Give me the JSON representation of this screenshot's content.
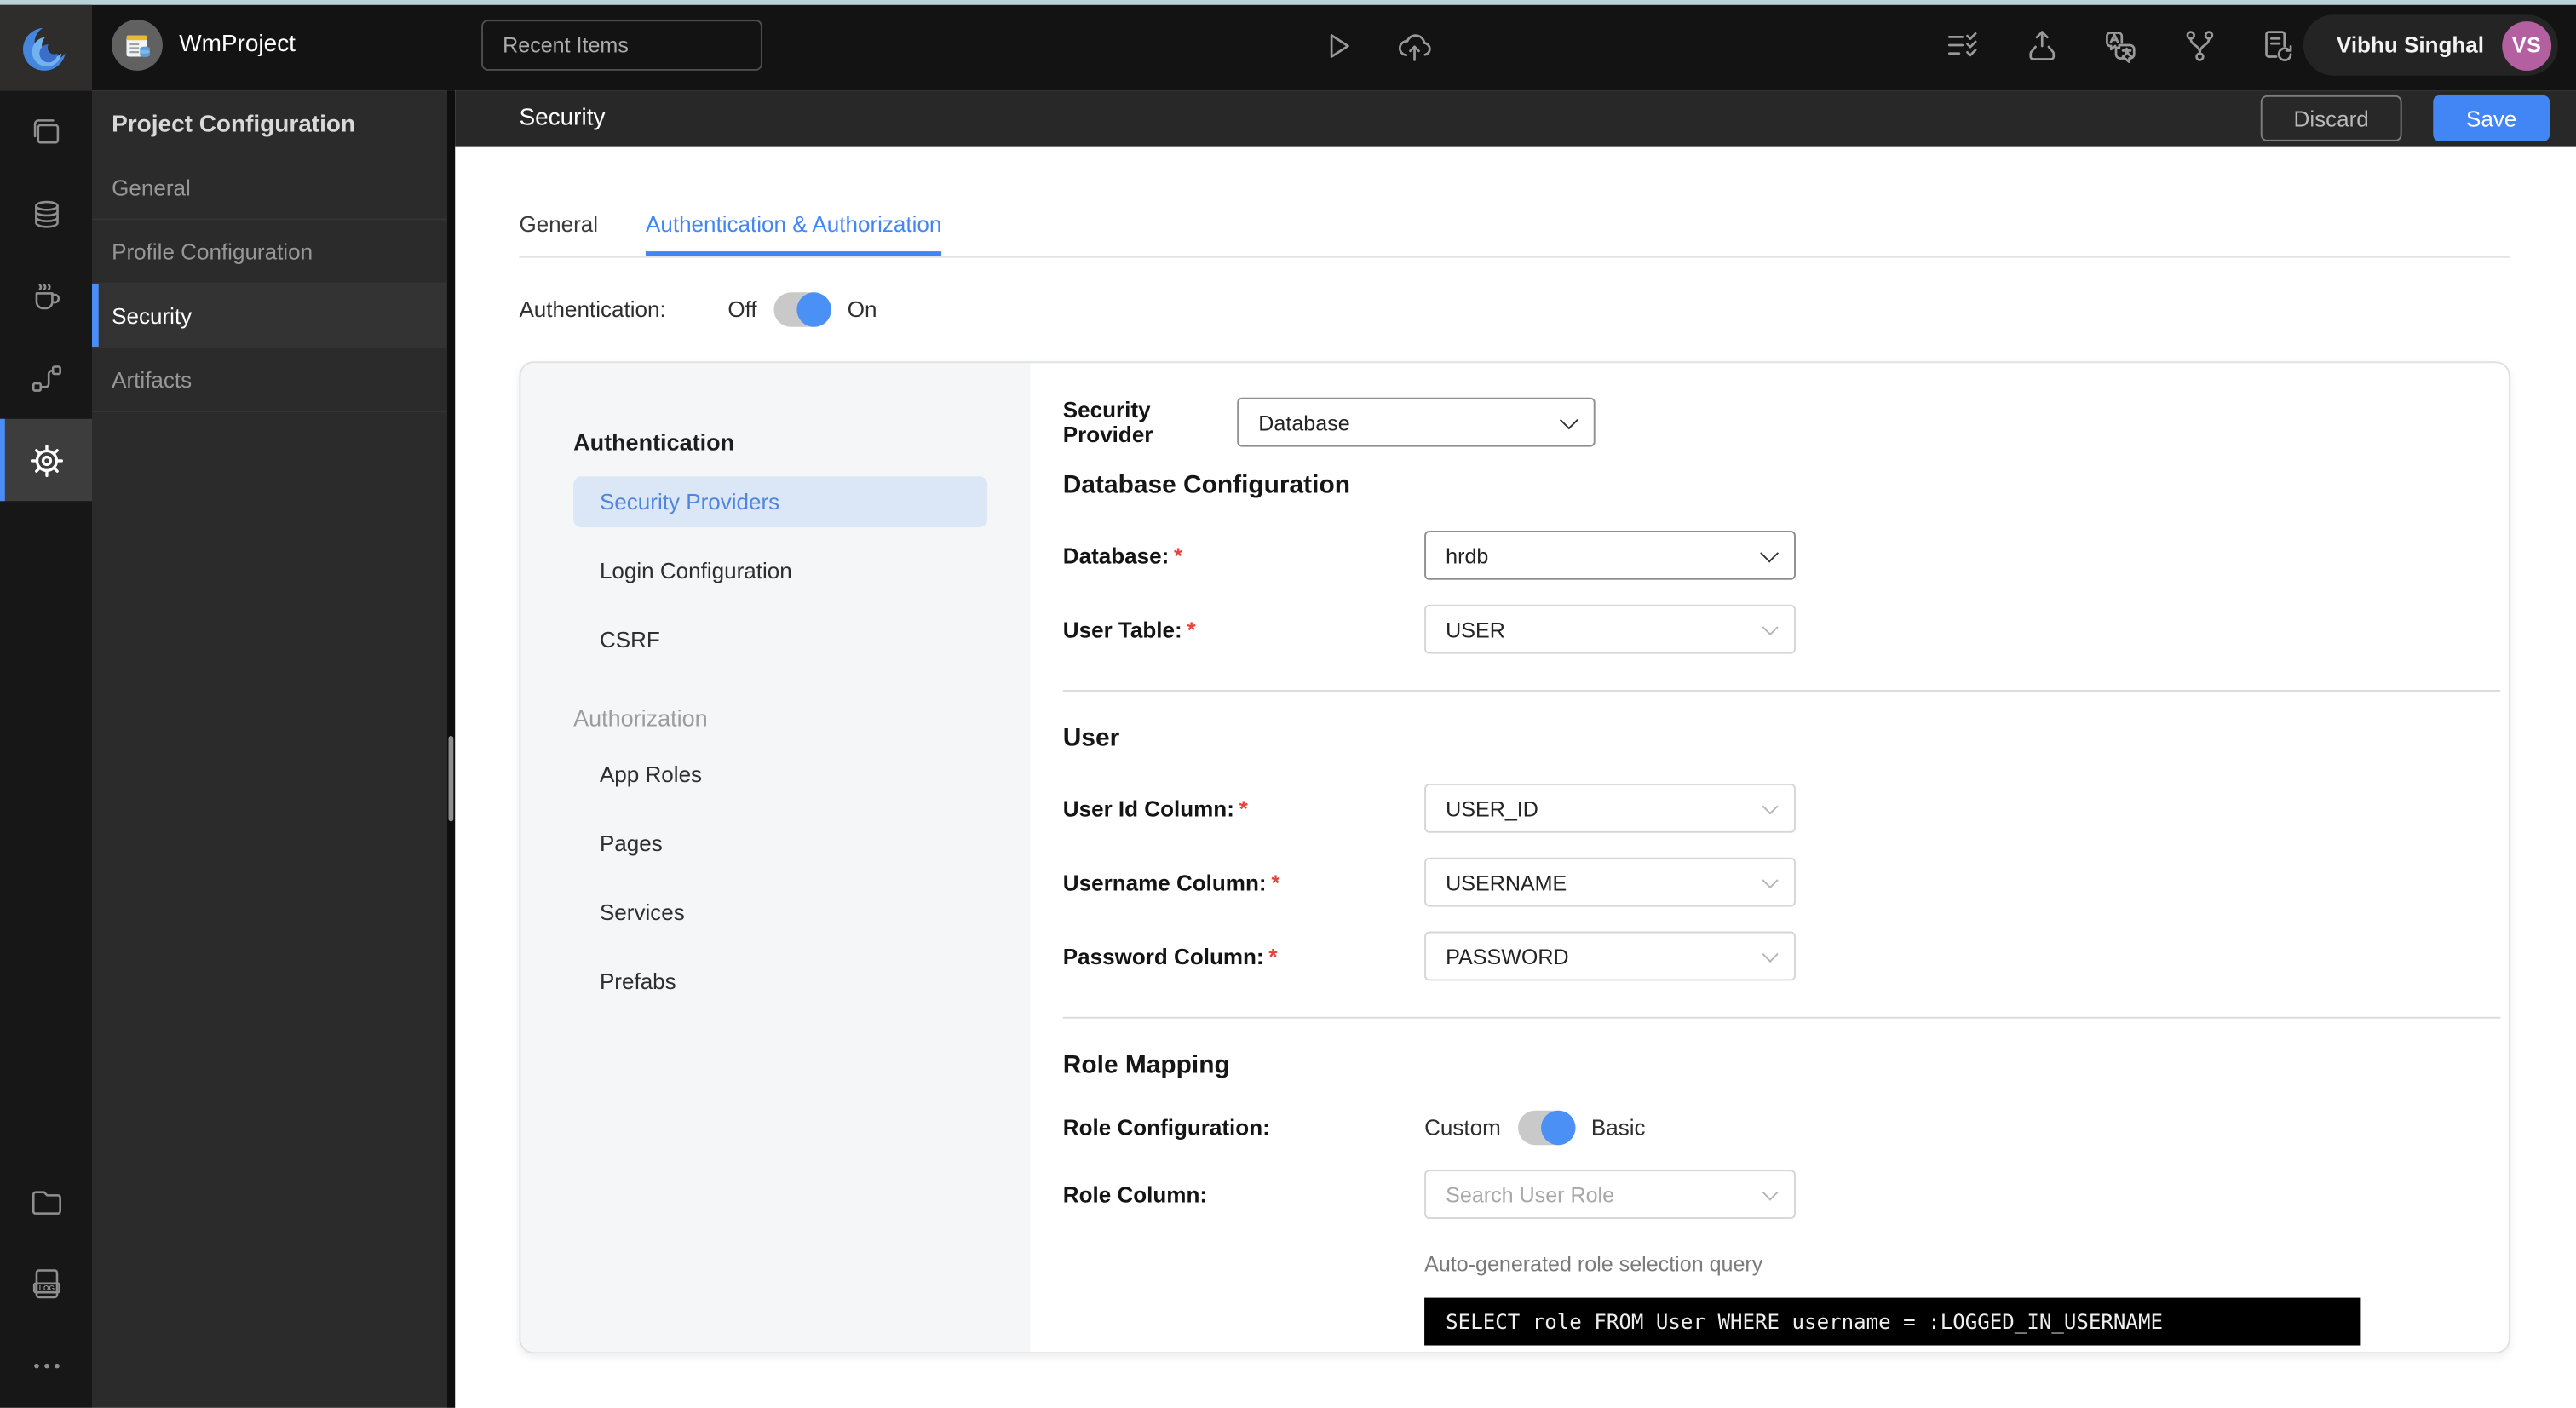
{
  "topbar": {
    "project_name": "WmProject",
    "recent_items": "Recent Items",
    "user_name": "Vibhu Singhal",
    "user_initials": "VS"
  },
  "rail": {
    "log_badge": "LOG"
  },
  "sidebar": {
    "title": "Project Configuration",
    "items": [
      {
        "label": "General"
      },
      {
        "label": "Profile Configuration"
      },
      {
        "label": "Security"
      },
      {
        "label": "Artifacts"
      }
    ]
  },
  "page_header": {
    "title": "Security",
    "discard": "Discard",
    "save": "Save"
  },
  "tabs": {
    "general": "General",
    "auth": "Authentication & Authorization"
  },
  "auth_row": {
    "label": "Authentication:",
    "off": "Off",
    "on": "On"
  },
  "panel_nav": {
    "auth_heading": "Authentication",
    "items_auth": [
      "Security Providers",
      "Login Configuration",
      "CSRF"
    ],
    "authz_heading": "Authorization",
    "items_authz": [
      "App Roles",
      "Pages",
      "Services",
      "Prefabs"
    ]
  },
  "form": {
    "required_marker": "*",
    "security_provider_label": "Security Provider",
    "security_provider_value": "Database",
    "db_section_title": "Database Configuration",
    "database_label": "Database:",
    "database_value": "hrdb",
    "user_table_label": "User Table:",
    "user_table_value": "USER",
    "user_section_title": "User",
    "user_id_label": "User Id Column:",
    "user_id_value": "USER_ID",
    "username_label": "Username Column:",
    "username_value": "USERNAME",
    "password_label": "Password Column:",
    "password_value": "PASSWORD",
    "role_section_title": "Role Mapping",
    "role_config_label": "Role Configuration:",
    "role_custom": "Custom",
    "role_basic": "Basic",
    "role_column_label": "Role Column:",
    "role_column_placeholder": "Search User Role",
    "query_caption": "Auto-generated role selection query",
    "query_sql": "SELECT role FROM User WHERE username = :LOGGED_IN_USERNAME"
  },
  "colors": {
    "accent_blue": "#4285F4",
    "rail_accent": "#4B8DF8",
    "avatar_purple": "#B35FA0",
    "nav_selected_bg": "#DBE7F7",
    "nav_selected_text": "#4E86DD",
    "code_bg": "#000000",
    "topbar_bg": "#141313",
    "sidebar_bg": "#2B2B2B",
    "required_red": "#E5443C"
  }
}
